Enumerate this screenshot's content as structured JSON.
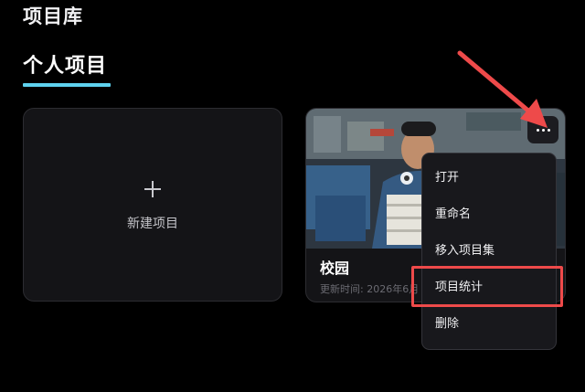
{
  "header": {
    "title": "项目库"
  },
  "tabs": [
    {
      "label": "个人项目",
      "active": true
    }
  ],
  "new_project": {
    "label": "新建项目",
    "icon": "plus-icon"
  },
  "project": {
    "name": "校园",
    "updated": "更新时间: 2026年6月",
    "more_icon": "more-horizontal-icon"
  },
  "context_menu": {
    "items": [
      "打开",
      "重命名",
      "移入项目集",
      "项目统计",
      "删除"
    ],
    "highlighted": "项目统计"
  },
  "colors": {
    "background": "#000000",
    "card": "#141417",
    "tab_underline": "#5ed2ee",
    "annotation": "#ee4a4a",
    "menu": "#18181c"
  }
}
